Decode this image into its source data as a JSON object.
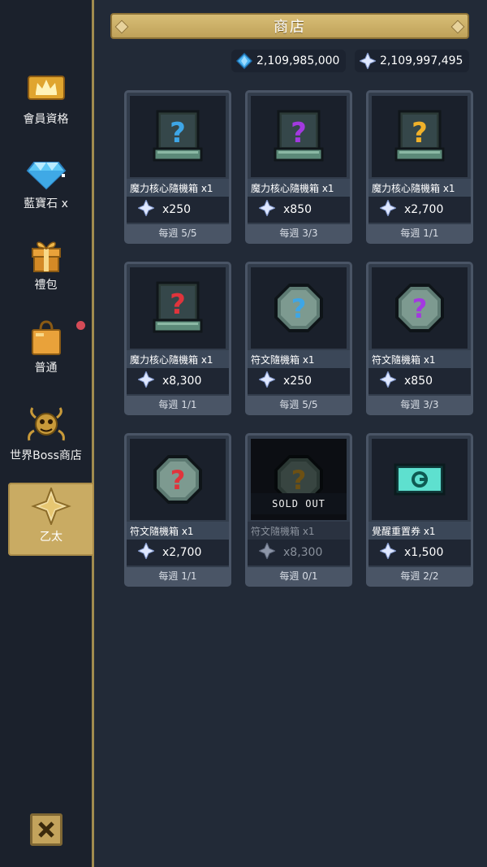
{
  "title": "商店",
  "currencies": [
    {
      "icon": "blue-gem-icon",
      "amount": "2,109,985,000"
    },
    {
      "icon": "ether-crystal-icon",
      "amount": "2,109,997,495"
    }
  ],
  "sidebar": {
    "items": [
      {
        "label": "會員資格",
        "icon": "crown-icon"
      },
      {
        "label": "藍寶石 x",
        "icon": "diamond-icon"
      },
      {
        "label": "禮包",
        "icon": "gift-icon"
      },
      {
        "label": "普通",
        "icon": "shopping-bag-icon"
      },
      {
        "label": "世界Boss商店",
        "icon": "boss-emblem-icon"
      },
      {
        "label": "乙太",
        "icon": "ether-crystal-icon"
      }
    ],
    "active_index": 5
  },
  "soldout_label": "SOLD OUT",
  "items": [
    {
      "name": "魔力核心隨機箱 x1",
      "price": "x250",
      "limit": "每週 5/5",
      "color": "#3ea6e6",
      "shape": "box"
    },
    {
      "name": "魔力核心隨機箱 x1",
      "price": "x850",
      "limit": "每週 3/3",
      "color": "#a339e0",
      "shape": "box"
    },
    {
      "name": "魔力核心隨機箱 x1",
      "price": "x2,700",
      "limit": "每週 1/1",
      "color": "#f0b12a",
      "shape": "box"
    },
    {
      "name": "魔力核心隨機箱 x1",
      "price": "x8,300",
      "limit": "每週 1/1",
      "color": "#e0343c",
      "shape": "box"
    },
    {
      "name": "符文隨機箱 x1",
      "price": "x250",
      "limit": "每週 5/5",
      "color": "#3ea6e6",
      "shape": "rune"
    },
    {
      "name": "符文隨機箱 x1",
      "price": "x850",
      "limit": "每週 3/3",
      "color": "#a339e0",
      "shape": "rune"
    },
    {
      "name": "符文隨機箱 x1",
      "price": "x2,700",
      "limit": "每週 1/1",
      "color": "#e0343c",
      "shape": "rune"
    },
    {
      "name": "符文隨機箱 x1",
      "price": "x8,300",
      "limit": "每週 0/1",
      "color": "#f0b12a",
      "shape": "rune",
      "sold_out": true
    },
    {
      "name": "覺醒重置券 x1",
      "price": "x1,500",
      "limit": "每週 2/2",
      "color": "#5ee0cf",
      "shape": "ticket"
    }
  ]
}
